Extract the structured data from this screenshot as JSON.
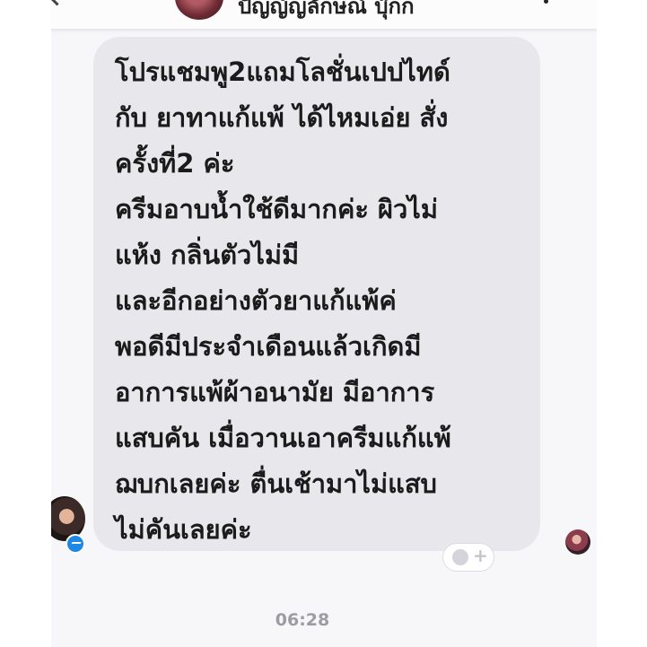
{
  "header": {
    "contact_name": "ปัญญ์ญลักษณ์ บุ๊กก"
  },
  "message": {
    "lines": [
      "โปรแชมพู2แถมโลชั่นเปปไทด์",
      "กับ ยาทาแก้แพ้  ได้ไหมเอ่ย สั่ง",
      "ครั้งที่2 ค่ะ",
      "ครีมอาบน้ำใช้ดีมากค่ะ ผิวไม่",
      "แห้ง กลิ่นตัวไม่มี",
      "และอีกอย่างตัวยาแก้แพ้ค่",
      "พอดีมีประจำเดือนแล้วเกิดมี",
      "อาการแพ้ผ้าอนามัย มีอาการ",
      "แสบคัน เมื่อวานเอาครีมแก้แพ้",
      "ฌบกเลยค่ะ  ตื่นเช้ามาไม่แสบ",
      "ไม่คันเลยค่ะ"
    ]
  },
  "reaction": {
    "plus_label": "+"
  },
  "timestamp": "06:28",
  "colors": {
    "bubble": "#e8e8ec",
    "messenger_badge": "#1e88e5",
    "timestamp": "#9c9ca2"
  }
}
